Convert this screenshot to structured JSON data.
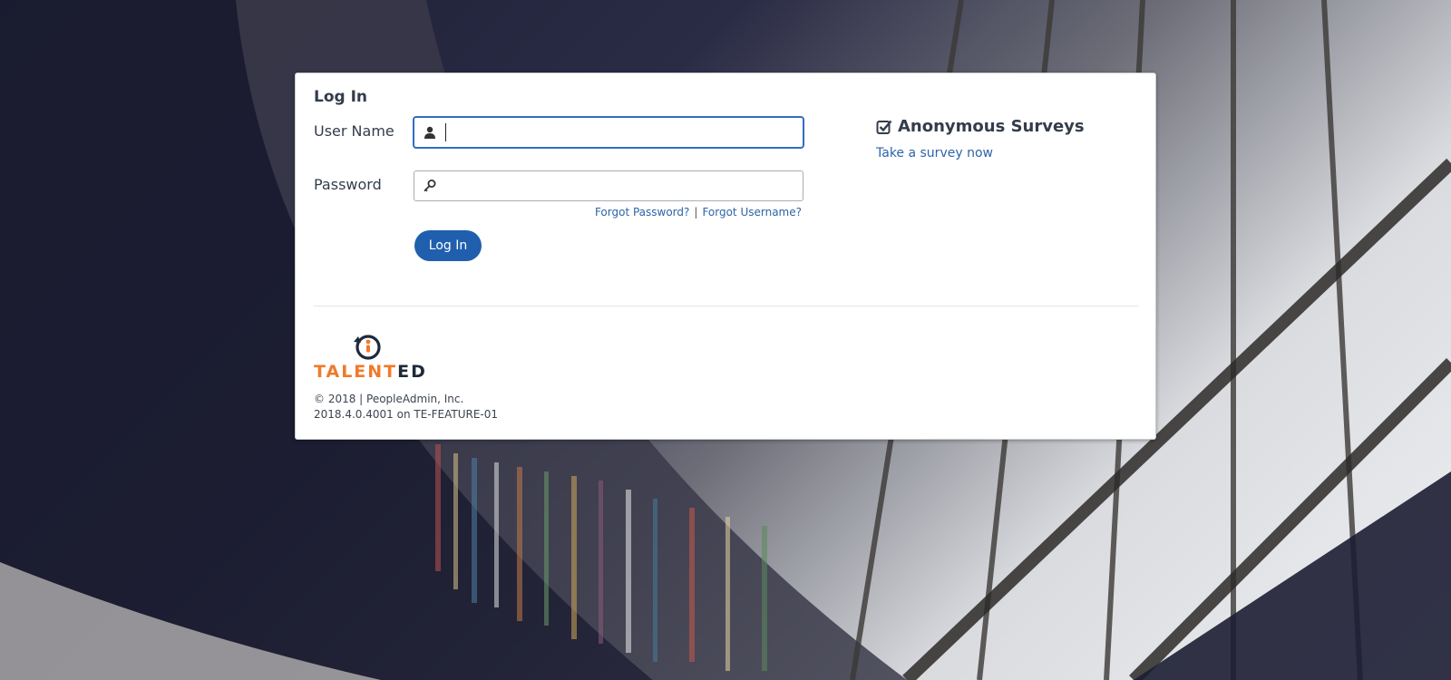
{
  "login": {
    "title": "Log In",
    "username_label": "User Name",
    "username_value": "",
    "password_label": "Password",
    "password_value": "",
    "forgot_password": "Forgot Password?",
    "separator": "|",
    "forgot_username": "Forgot Username?",
    "button_label": "Log In"
  },
  "surveys": {
    "heading": "Anonymous Surveys",
    "link": "Take a survey now"
  },
  "footer": {
    "logo_part1": "TALENT",
    "logo_part2": "ED",
    "copyright": "© 2018 | PeopleAdmin, Inc.",
    "version": "2018.4.0.4001 on TE-FEATURE-01"
  },
  "colors": {
    "accent": "#1f5fae",
    "link": "#2d64a8",
    "logo_orange": "#f07a2b",
    "logo_navy": "#1e2a3a"
  },
  "icons": {
    "username": "user-icon",
    "password": "key-icon",
    "surveys": "checkbox-checked-icon",
    "logo": "talented-logo-icon"
  }
}
